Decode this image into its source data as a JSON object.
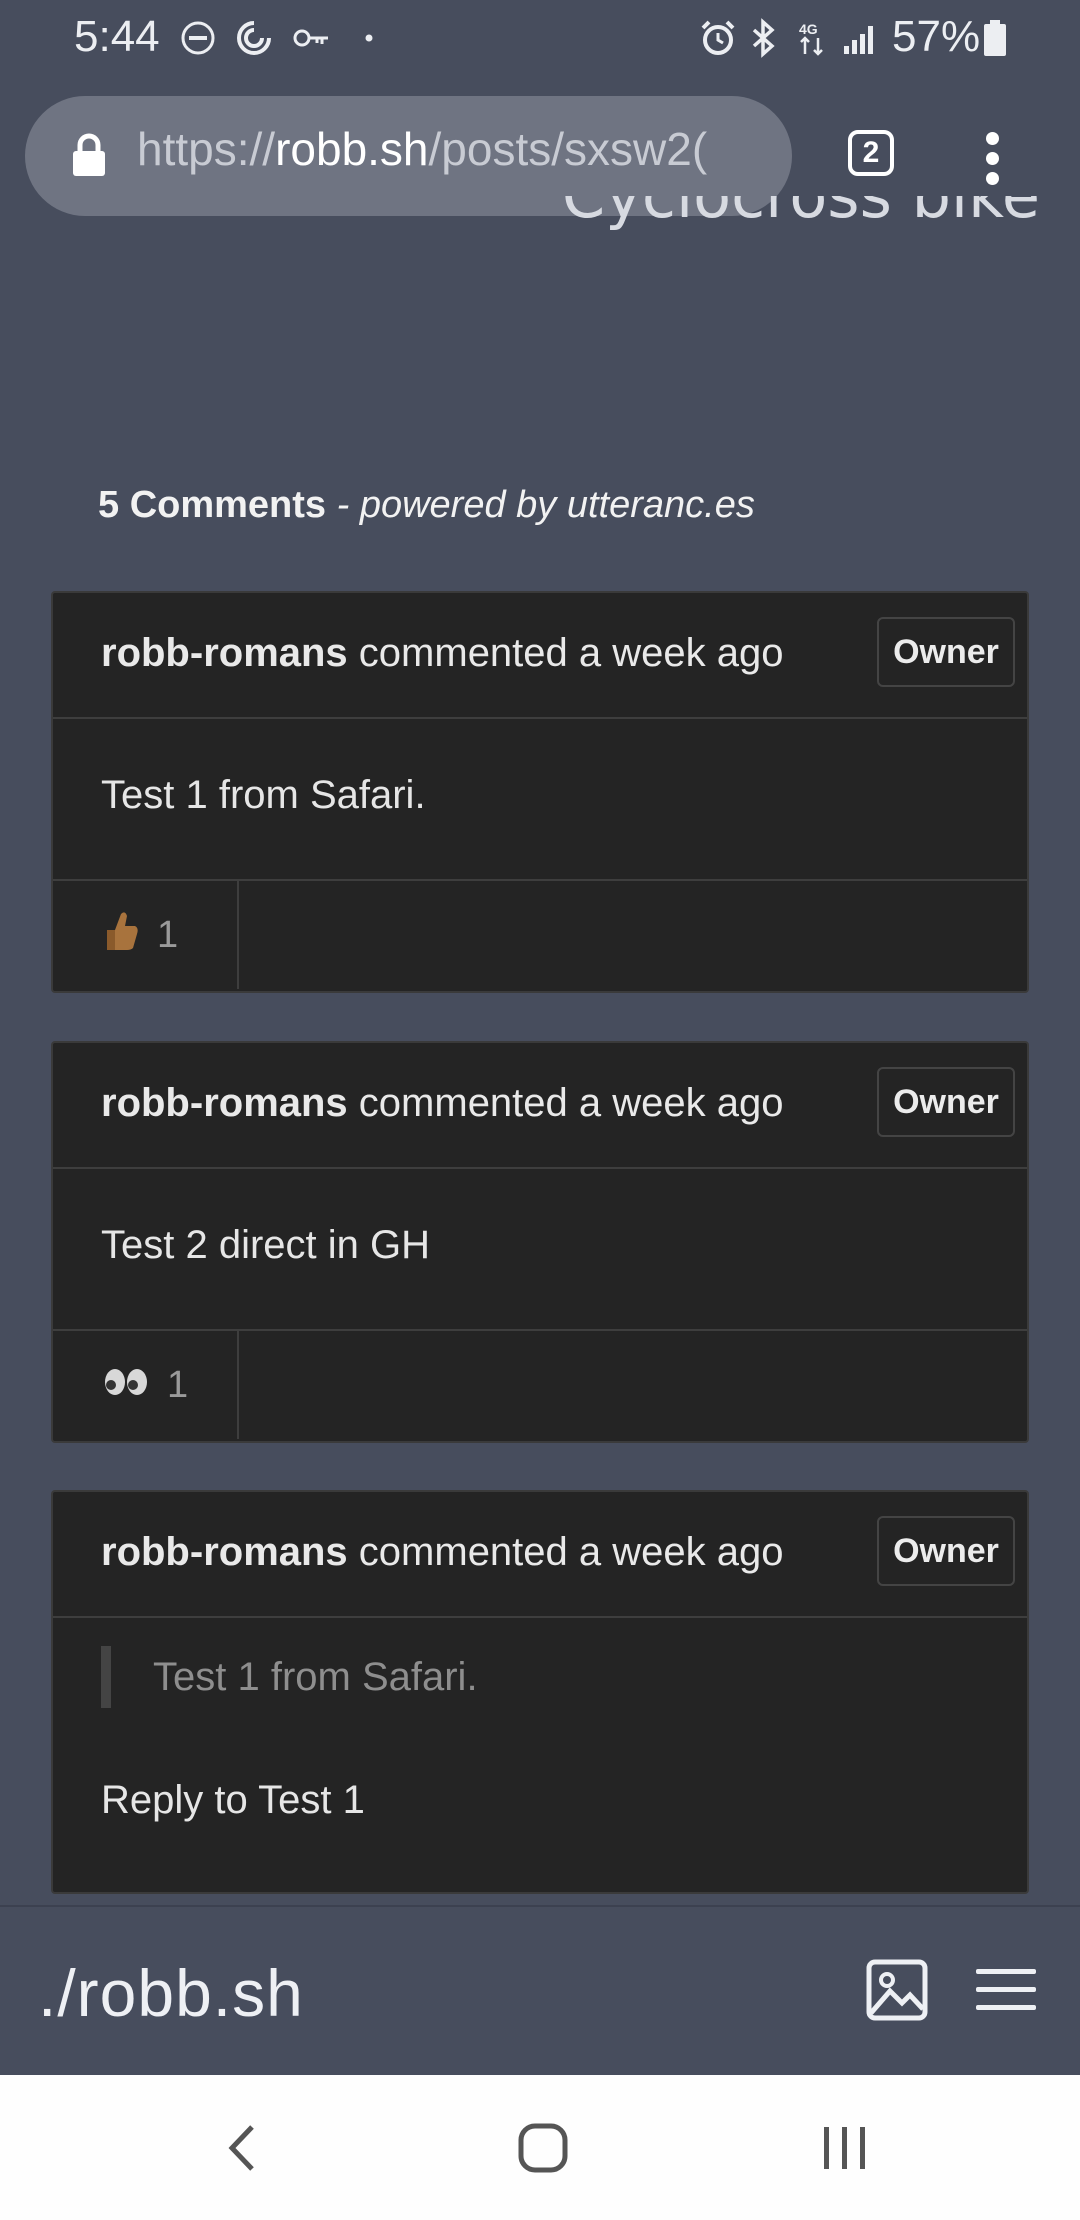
{
  "status_bar": {
    "time": "5:44",
    "battery": "57%"
  },
  "browser": {
    "url_scheme": "https://",
    "url_host": "robb.sh",
    "url_path": "/posts/sxsw2(",
    "tab_count": "2"
  },
  "page": {
    "heading_fragment": "Cyclocross bike"
  },
  "comments_section": {
    "count_label": "5 Comments",
    "powered_by": " - powered by utteranc.es"
  },
  "comments": [
    {
      "author": "robb-romans",
      "meta": " commented a week ago",
      "badge": "Owner",
      "body": "Test 1 from Safari.",
      "reaction_icon": "thumbs-up-icon",
      "reaction_count": "1"
    },
    {
      "author": "robb-romans",
      "meta": " commented a week ago",
      "badge": "Owner",
      "body": "Test 2 direct in GH",
      "reaction_icon": "eyes-icon",
      "reaction_count": "1"
    },
    {
      "author": "robb-romans",
      "meta": " commented a week ago",
      "badge": "Owner",
      "quote": "Test 1 from Safari.",
      "body": "Reply to Test 1"
    }
  ],
  "site_nav": {
    "brand": "./robb.sh"
  },
  "colors": {
    "page_bg": "#474d5d",
    "comment_bg": "#242424",
    "url_bar_bg": "#6f7482"
  }
}
